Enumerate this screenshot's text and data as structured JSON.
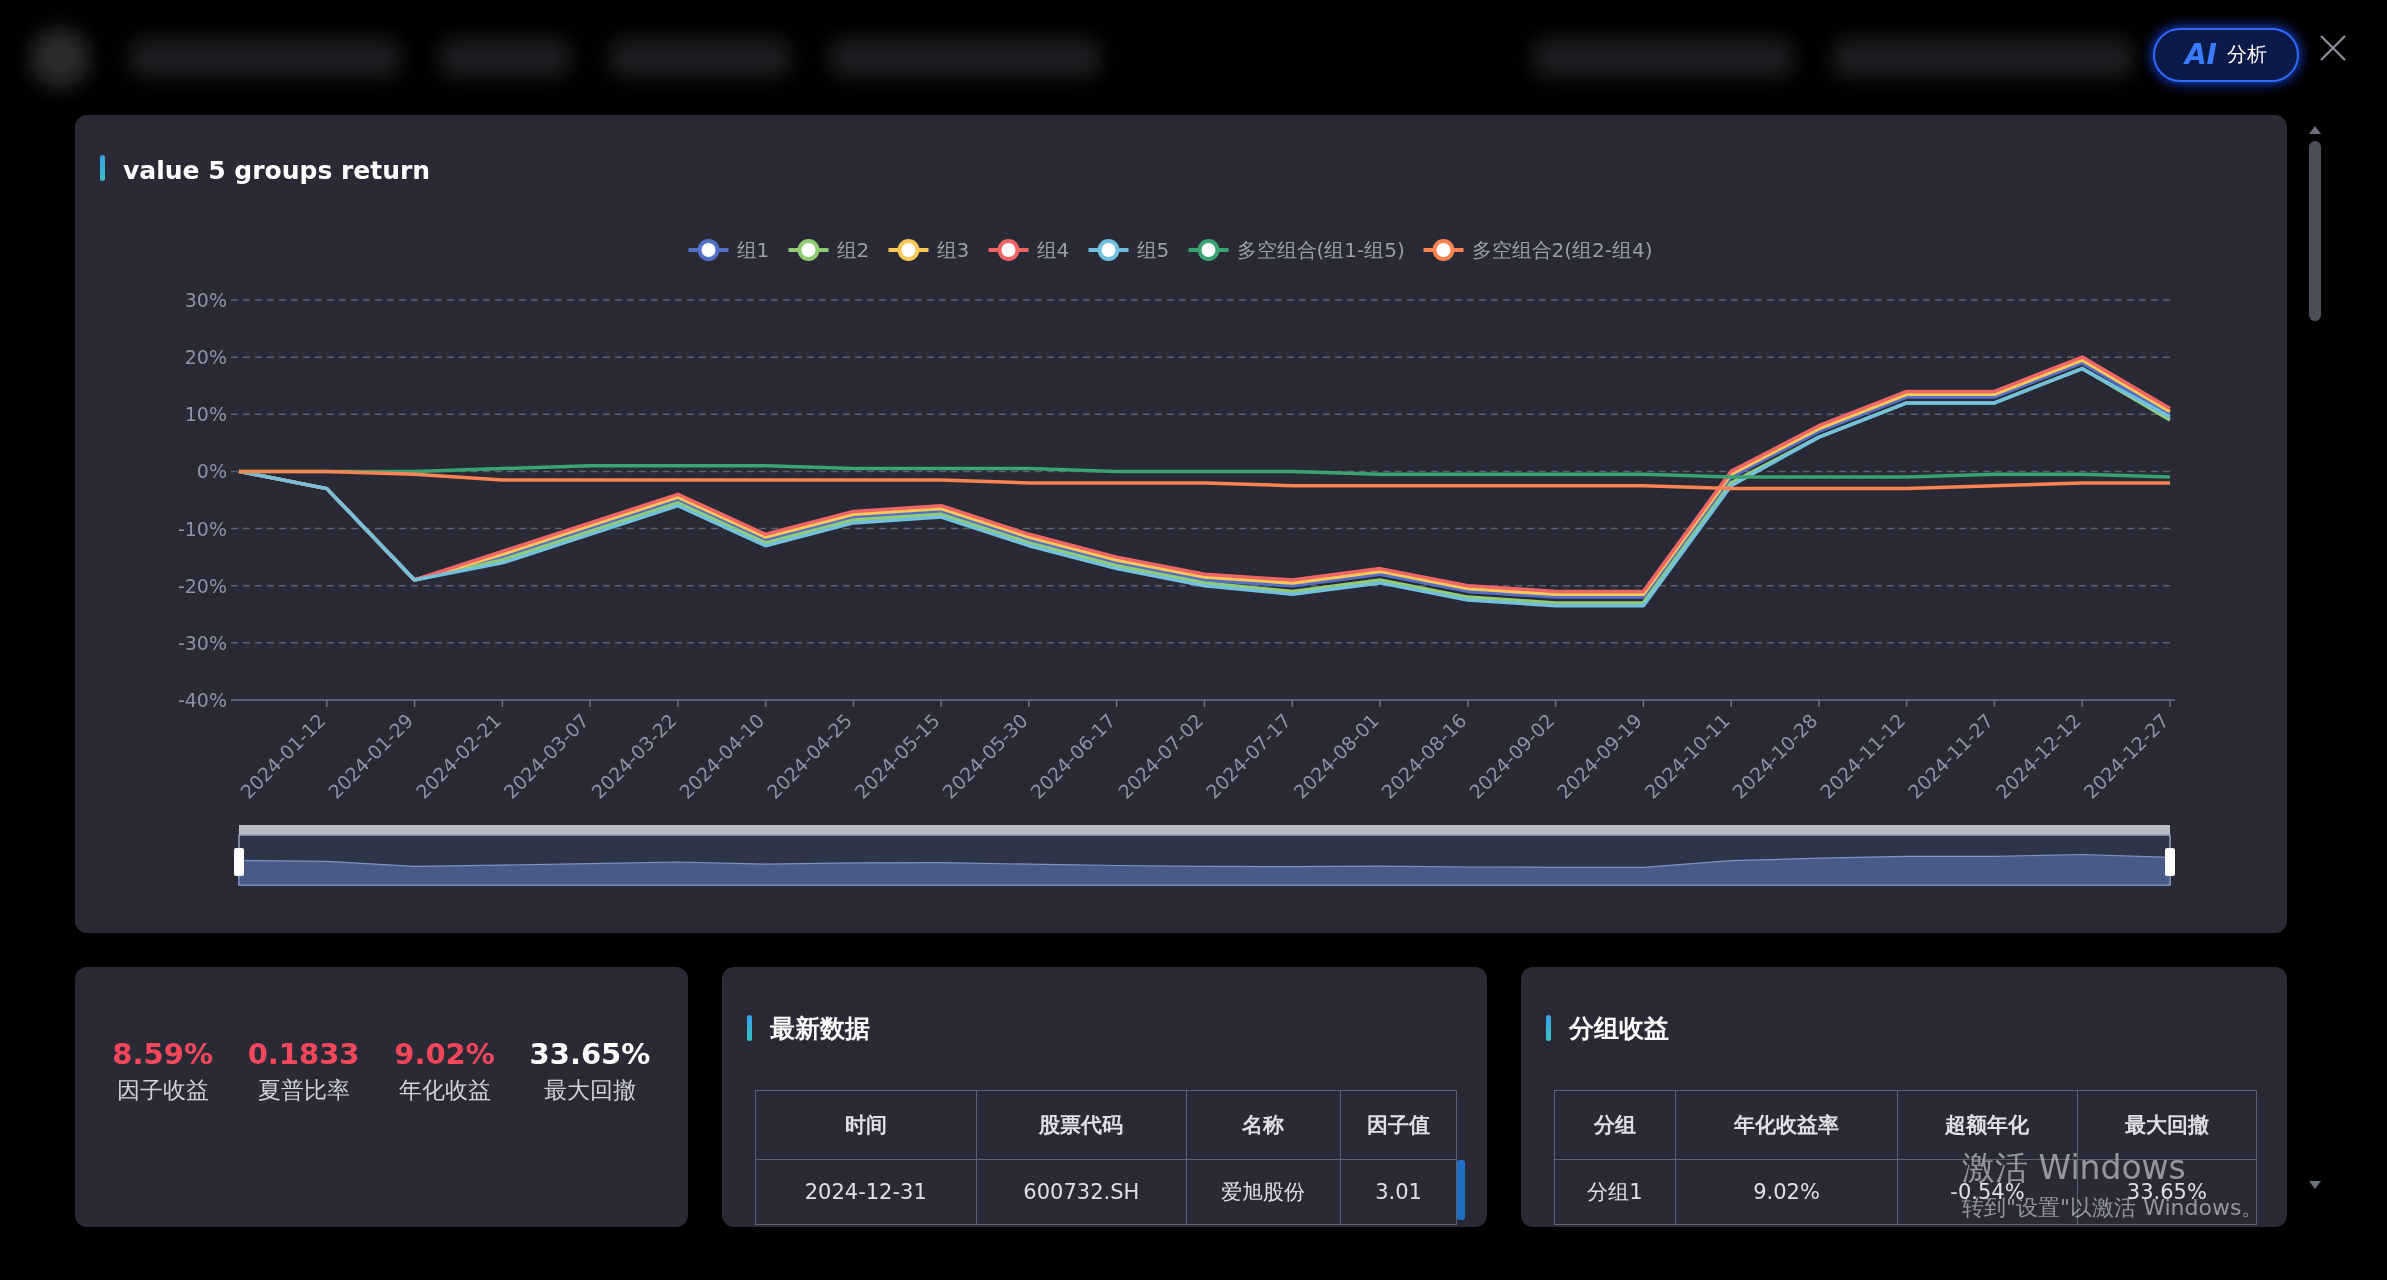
{
  "top_bar": {
    "ai_button": {
      "badge": "AI",
      "label": "分析"
    }
  },
  "chart_panel": {
    "title": "value 5 groups return",
    "chart_data": {
      "type": "line",
      "grid": true,
      "legend": "top",
      "categories": [
        null,
        "2024-01-12",
        "2024-01-29",
        "2024-02-21",
        "2024-03-07",
        "2024-03-22",
        "2024-04-10",
        "2024-04-25",
        "2024-05-15",
        "2024-05-30",
        "2024-06-17",
        "2024-07-02",
        "2024-07-17",
        "2024-08-01",
        "2024-08-16",
        "2024-09-02",
        "2024-09-19",
        "2024-10-11",
        "2024-10-28",
        "2024-11-12",
        "2024-11-27",
        "2024-12-12",
        "2024-12-27"
      ],
      "ylim": [
        -40,
        30
      ],
      "yticks": [
        {
          "value": 30,
          "label": "30%"
        },
        {
          "value": 20,
          "label": "20%"
        },
        {
          "value": 10,
          "label": "10%"
        },
        {
          "value": 0,
          "label": "0%"
        },
        {
          "value": -10,
          "label": "-10%"
        },
        {
          "value": -20,
          "label": "-20%"
        },
        {
          "value": -30,
          "label": "-30%"
        },
        {
          "value": -40,
          "label": "-40%"
        }
      ],
      "series": [
        {
          "name": "组1",
          "color": "#5470c6",
          "values": [
            0,
            -3,
            -19,
            -15,
            -10,
            -5,
            -12,
            -8,
            -7,
            -12,
            -16,
            -19,
            -20,
            -18,
            -21,
            -22,
            -22,
            -1,
            7,
            13,
            13,
            19,
            10
          ]
        },
        {
          "name": "组2",
          "color": "#91cc75",
          "values": [
            0,
            -3,
            -19,
            -15.5,
            -10.5,
            -5.5,
            -12.5,
            -8.5,
            -7.5,
            -12.5,
            -16.5,
            -19.5,
            -21,
            -19,
            -22,
            -23,
            -23,
            -2,
            6,
            12,
            12,
            18,
            9
          ]
        },
        {
          "name": "组3",
          "color": "#fac858",
          "values": [
            0,
            -3,
            -19,
            -14.5,
            -9.5,
            -4.5,
            -11.5,
            -7.5,
            -6.5,
            -11.5,
            -15.5,
            -18.5,
            -19.5,
            -17.5,
            -20.5,
            -21.5,
            -21.5,
            -0.5,
            7.5,
            13.5,
            13.5,
            19.5,
            10.5
          ]
        },
        {
          "name": "组4",
          "color": "#ee6666",
          "values": [
            0,
            -3,
            -19,
            -14,
            -9,
            -4,
            -11,
            -7,
            -6,
            -11,
            -15,
            -18,
            -19,
            -17,
            -20,
            -21,
            -21,
            0,
            8,
            14,
            14,
            20,
            11
          ]
        },
        {
          "name": "组5",
          "color": "#73c0de",
          "values": [
            0,
            -3,
            -19,
            -16,
            -11,
            -6,
            -13,
            -9,
            -8,
            -13,
            -17,
            -20,
            -21.5,
            -19.5,
            -22.5,
            -23.5,
            -23.5,
            -2.5,
            6,
            12,
            12,
            18,
            9.5
          ]
        },
        {
          "name": "多空组合(组1-组5)",
          "color": "#3ba272",
          "values": [
            0,
            0,
            0,
            0.5,
            1,
            1,
            1,
            0.5,
            0.5,
            0.5,
            0,
            0,
            0,
            -0.5,
            -0.5,
            -0.5,
            -0.5,
            -1,
            -1,
            -1,
            -0.5,
            -0.5,
            -1
          ]
        },
        {
          "name": "多空组合2(组2-组4)",
          "color": "#fc8452",
          "values": [
            0,
            0,
            -0.5,
            -1.5,
            -1.5,
            -1.5,
            -1.5,
            -1.5,
            -1.5,
            -2,
            -2,
            -2,
            -2.5,
            -2.5,
            -2.5,
            -2.5,
            -2.5,
            -3,
            -3,
            -3,
            -2.5,
            -2,
            -2
          ]
        }
      ]
    }
  },
  "stats": [
    {
      "value": "8.59%",
      "label": "因子收益",
      "color": "#f5475b"
    },
    {
      "value": "0.1833",
      "label": "夏普比率",
      "color": "#f5475b"
    },
    {
      "value": "9.02%",
      "label": "年化收益",
      "color": "#f5475b"
    },
    {
      "value": "33.65%",
      "label": "最大回撤",
      "color": "#ffffff"
    }
  ],
  "latest_data": {
    "title": "最新数据",
    "columns": [
      "时间",
      "股票代码",
      "名称",
      "因子值"
    ],
    "rows": [
      [
        "2024-12-31",
        "600732.SH",
        "爱旭股份",
        "3.01"
      ]
    ]
  },
  "group_returns": {
    "title": "分组收益",
    "columns": [
      "分组",
      "年化收益率",
      "超额年化",
      "最大回撤"
    ],
    "rows": [
      [
        "分组1",
        "9.02%",
        "-0.54%",
        "33.65%"
      ]
    ]
  },
  "os_notice": {
    "title": "激活 Windows",
    "text": "转到\"设置\"以激活 Windows。"
  }
}
